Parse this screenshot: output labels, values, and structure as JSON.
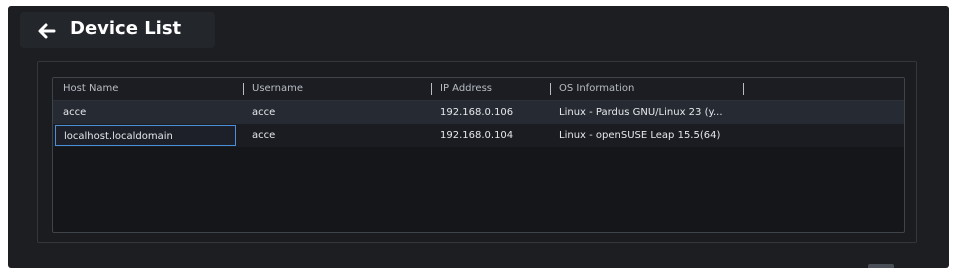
{
  "header": {
    "title": "Device List",
    "back_icon": "arrow-left-icon"
  },
  "table": {
    "columns": [
      "Host Name",
      "Username",
      "IP Address",
      "OS Information"
    ],
    "rows": [
      {
        "host_name": "acce",
        "username": "acce",
        "ip_address": "192.168.0.106",
        "os_information": "Linux - Pardus GNU/Linux 23 (y..."
      },
      {
        "host_name": "localhost.localdomain",
        "username": "acce",
        "ip_address": "192.168.0.104",
        "os_information": "Linux - openSUSE Leap 15.5(64)"
      }
    ]
  },
  "colors": {
    "background": "#1c1e22",
    "selected_row": "#262a33",
    "focus_border": "#4a90d9",
    "text": "#e6e8eb"
  }
}
